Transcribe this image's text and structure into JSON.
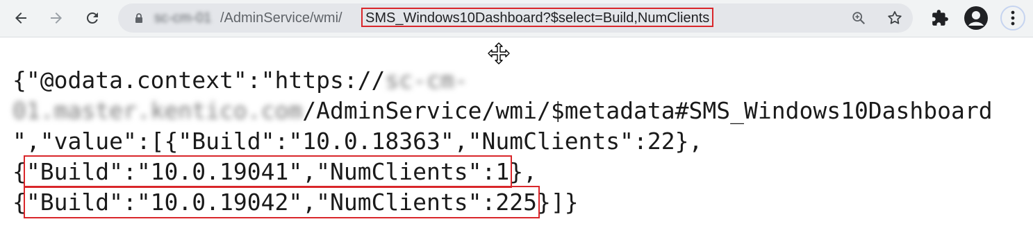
{
  "browser": {
    "url_host": "sc-cm-01",
    "url_path": "/AdminService/wmi/",
    "url_query": "SMS_Windows10Dashboard?$select=Build,NumClients"
  },
  "icons": [
    "back-arrow-icon",
    "forward-arrow-icon",
    "reload-icon",
    "lock-icon",
    "zoom-icon",
    "star-icon",
    "extensions-icon",
    "profile-icon",
    "more-menu-icon",
    "move-cursor-icon"
  ],
  "colors": {
    "highlight": "#d9262a",
    "toolbar": "#f1f3f4",
    "omnibox": "#e4e6ea"
  },
  "json": {
    "line1_prefix": "{\"@odata.context\":\"https://",
    "line1_blur": "sc-cm-",
    "line2_blur": "01.master.kentico.com",
    "line2_rest": "/AdminService/wmi/$metadata#SMS_Windows10Dashboard",
    "line3": "\",\"value\":[{\"Build\":\"10.0.18363\",\"NumClients\":22},",
    "line4_open": "{",
    "line4_record": "\"Build\":\"10.0.19041\",\"NumClients\":1",
    "line4_close": "},",
    "line5_open": "{",
    "line5_record": "\"Build\":\"10.0.19042\",\"NumClients\":225",
    "line5_close": "}]}"
  }
}
